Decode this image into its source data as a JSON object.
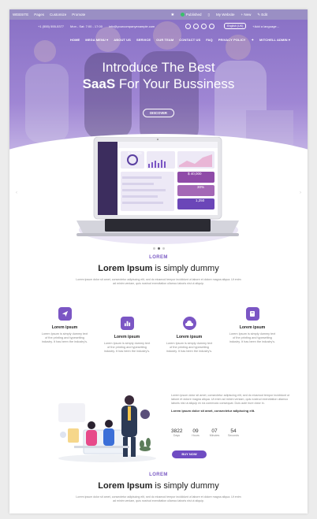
{
  "adminbar": {
    "site": "WEBSITE",
    "items": [
      "Pages",
      "Customize",
      "Promote"
    ],
    "published": "Published",
    "my_website": "My Website",
    "new": "+ New",
    "edit": "✎ Edit"
  },
  "topbar": {
    "phone": "+1 (555) 555-5377",
    "hours": "Mon - Sat: 7:00 - 17:00",
    "email": "info@yourcompanyexample.com",
    "lang": "English (UK)",
    "add_lang": "+Add a language..."
  },
  "nav": [
    "HOME",
    "MEGA MENU ▾",
    "ABOUT US",
    "SERVICE",
    "OUR TEAM",
    "CONTACT US",
    "FAQ",
    "PRIVACY POLICY",
    "✦",
    "MITCHELL ADMIN ▾"
  ],
  "hero": {
    "line1": "Introduce The Best",
    "line2_bold": "SaaS",
    "line2_rest": "For Your Bussiness",
    "button": "DISCOVER"
  },
  "section1": {
    "eyebrow": "LOREM",
    "title_bold": "Lorem Ipsum",
    "title_rest": " is simply dummy",
    "para": "Lorem ipsum dolor sit amet, consectetur adipiscing elit, sed do eiusmod tempor incididunt ut labore et dolore magna aliqua. Ut enim ad minim veniam, quis nostrud exercitation ullamco laboris nisi ut aliquip."
  },
  "features": [
    {
      "icon": "send-icon",
      "title": "Lorem ipsum",
      "desc": "Lorem Ipsum is simply dummy text of the printing and typesetting industry. It has been the industry's."
    },
    {
      "icon": "chart-icon",
      "title": "Lorem ipsum",
      "desc": "Lorem Ipsum is simply dummy text of the printing and typesetting industry. It has been the industry's."
    },
    {
      "icon": "cloud-icon",
      "title": "Lorem ipsum",
      "desc": "Lorem Ipsum is simply dummy text of the printing and typesetting industry. It has been the industry's."
    },
    {
      "icon": "book-icon",
      "title": "Lorem ipsum",
      "desc": "Lorem Ipsum is simply dummy text of the printing and typesetting industry. It has been the industry's."
    }
  ],
  "promo": {
    "para": "Lorem ipsum dolor sit amet, consectetur adipiscing elit, sed do eiusmod tempor incididunt ut labore et dolore magna aliqua. Ut enim ad minim veniam, quis nostrud exercitation ullamco laboris nisi ut aliquip ex ea commodo consequat. Duis aute irure dolor in.",
    "bold": "Lorem ipsum dolor sit amet, consectetur adipiscing elit.",
    "counters": [
      {
        "n": "3822",
        "l": "Days"
      },
      {
        "n": "09",
        "l": "Hours"
      },
      {
        "n": "07",
        "l": "Minutes"
      },
      {
        "n": "54",
        "l": "Seconds"
      }
    ],
    "button": "BUY NOW"
  },
  "section2": {
    "eyebrow": "LOREM",
    "title_bold": "Lorem Ipsum",
    "title_rest": " is simply dummy",
    "para": "Lorem ipsum dolor sit amet, consectetur adipiscing elit, sed do eiusmod tempor incididunt ut labore et dolore magna aliqua. Ut enim ad minim veniam, quis nostrud exercitation ullamco laboris nisi ut aliquip."
  },
  "dashboard": {
    "price": "$ 10,000",
    "stat1": "$ 40,000",
    "stat2": "30%",
    "stat3": "1,250"
  },
  "colors": {
    "accent": "#7b56c4",
    "hero": "#9a84d4"
  }
}
